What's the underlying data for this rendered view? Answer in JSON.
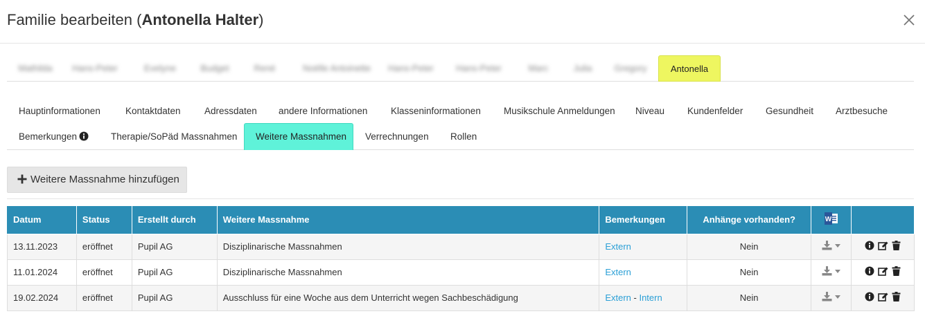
{
  "modal": {
    "title_prefix": "Familie bearbeiten (",
    "title_name": "Antonella Halter",
    "title_suffix": ")"
  },
  "member_tabs": [
    {
      "label": "Mathilda",
      "active": false
    },
    {
      "label": "Hans-Peter",
      "active": false
    },
    {
      "label": "Evelyne",
      "active": false
    },
    {
      "label": "Budget",
      "active": false
    },
    {
      "label": "René",
      "active": false
    },
    {
      "label": "Noëlle Antoinette",
      "active": false
    },
    {
      "label": "Hans-Peter",
      "active": false
    },
    {
      "label": "Hans-Peter",
      "active": false
    },
    {
      "label": "Marc",
      "active": false
    },
    {
      "label": "Julia",
      "active": false
    },
    {
      "label": "Gregory",
      "active": false
    },
    {
      "label": "Antonella",
      "active": true
    }
  ],
  "section_tabs": {
    "row1": [
      "Hauptinformationen",
      "Kontaktdaten",
      "Adressdaten",
      "andere Informationen",
      "Klasseninformationen",
      "Musikschule Anmeldungen",
      "Niveau",
      "Kundenfelder",
      "Gesundheit",
      "Arztbesuche"
    ],
    "row2": [
      "Bemerkungen",
      "Therapie/SoPäd Massnahmen",
      "Weitere Massnahmen",
      "Verrechnungen",
      "Rollen"
    ],
    "active": "Weitere Massnahmen"
  },
  "add_button": {
    "label": "Weitere Massnahme hinzufügen"
  },
  "table": {
    "headers": {
      "datum": "Datum",
      "status": "Status",
      "erstellt": "Erstellt durch",
      "massnahme": "Weitere Massnahme",
      "bemerkungen": "Bemerkungen",
      "anhaenge": "Anhänge vorhanden?"
    },
    "rows": [
      {
        "datum": "13.11.2023",
        "status": "eröffnet",
        "erstellt": "Pupil AG",
        "massnahme": "Disziplinarische Massnahmen",
        "link1": "Extern",
        "sep": "",
        "link2": "",
        "anhaenge": "Nein"
      },
      {
        "datum": "11.01.2024",
        "status": "eröffnet",
        "erstellt": "Pupil AG",
        "massnahme": "Disziplinarische Massnahmen",
        "link1": "Extern",
        "sep": "",
        "link2": "",
        "anhaenge": "Nein"
      },
      {
        "datum": "19.02.2024",
        "status": "eröffnet",
        "erstellt": "Pupil AG",
        "massnahme": "Ausschluss für eine Woche aus dem Unterricht wegen Sachbeschädigung",
        "link1": "Extern",
        "sep": " - ",
        "link2": "Intern",
        "anhaenge": "Nein"
      }
    ]
  },
  "colors": {
    "header_blue": "#2b8db5",
    "active_member": "#eef660",
    "active_section": "#5ff2d9",
    "link": "#2a9fd6"
  }
}
